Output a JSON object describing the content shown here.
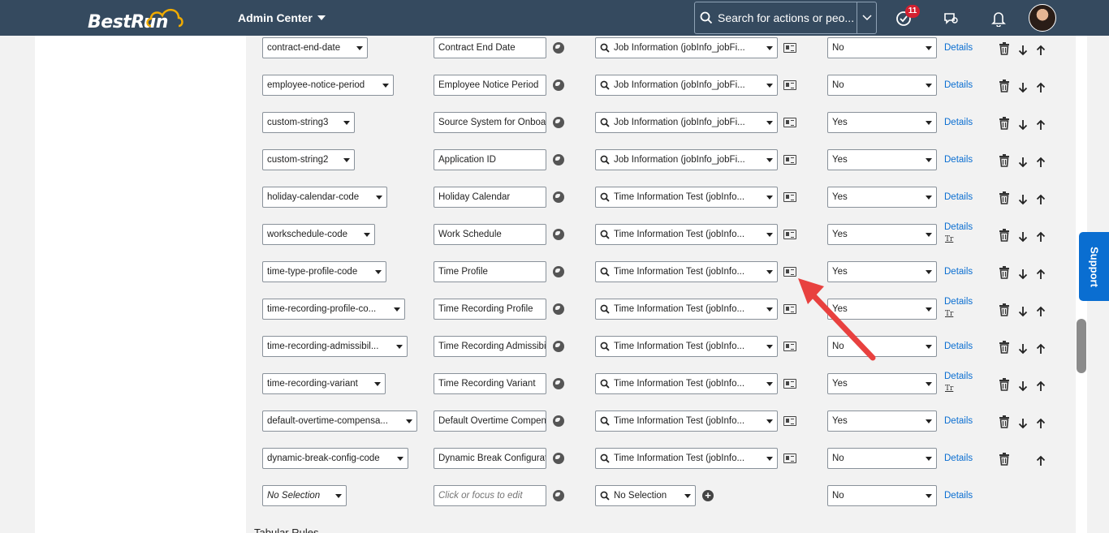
{
  "header": {
    "logo": "BestRun",
    "admin_center": "Admin Center",
    "search_placeholder": "Search for actions or peo...",
    "notification_count": "11"
  },
  "rows": [
    {
      "field": "contract-end-date",
      "label": "Contract End Date",
      "source": "Job Information (jobInfo_jobFi...",
      "visibility": "No",
      "details": "Details",
      "tr": "",
      "has_down": true
    },
    {
      "field": "employee-notice-period",
      "label": "Employee Notice Period",
      "source": "Job Information (jobInfo_jobFi...",
      "visibility": "No",
      "details": "Details",
      "tr": "",
      "has_down": true
    },
    {
      "field": "custom-string3",
      "label": "Source System for Onboarding",
      "source": "Job Information (jobInfo_jobFi...",
      "visibility": "Yes",
      "details": "Details",
      "tr": "",
      "has_down": true
    },
    {
      "field": "custom-string2",
      "label": "Application ID",
      "source": "Job Information (jobInfo_jobFi...",
      "visibility": "Yes",
      "details": "Details",
      "tr": "",
      "has_down": true
    },
    {
      "field": "holiday-calendar-code",
      "label": "Holiday Calendar",
      "source": "Time Information Test (jobInfo...",
      "visibility": "Yes",
      "details": "Details",
      "tr": "",
      "has_down": true
    },
    {
      "field": "workschedule-code",
      "label": "Work Schedule",
      "source": "Time Information Test (jobInfo...",
      "visibility": "Yes",
      "details": "Details",
      "tr": "Tr",
      "has_down": true
    },
    {
      "field": "time-type-profile-code",
      "label": "Time Profile",
      "source": "Time Information Test (jobInfo...",
      "visibility": "Yes",
      "details": "Details",
      "tr": "",
      "has_down": true
    },
    {
      "field": "time-recording-profile-co...",
      "label": "Time Recording Profile",
      "source": "Time Information Test (jobInfo...",
      "visibility": "Yes",
      "details": "Details",
      "tr": "Tr",
      "has_down": true
    },
    {
      "field": "time-recording-admissibil...",
      "label": "Time Recording Admissibility",
      "source": "Time Information Test (jobInfo...",
      "visibility": "No",
      "details": "Details",
      "tr": "",
      "has_down": true
    },
    {
      "field": "time-recording-variant",
      "label": "Time Recording Variant",
      "source": "Time Information Test (jobInfo...",
      "visibility": "Yes",
      "details": "Details",
      "tr": "Tr",
      "has_down": true
    },
    {
      "field": "default-overtime-compensa...",
      "label": "Default Overtime Compensation",
      "source": "Time Information Test (jobInfo...",
      "visibility": "Yes",
      "details": "Details",
      "tr": "",
      "has_down": true
    },
    {
      "field": "dynamic-break-config-code",
      "label": "Dynamic Break Configuration",
      "source": "Time Information Test (jobInfo...",
      "visibility": "No",
      "details": "Details",
      "tr": "",
      "has_down": false
    }
  ],
  "new_row": {
    "field": "No Selection",
    "label_placeholder": "Click or focus to edit",
    "source": "No Selection",
    "visibility": "No",
    "details": "Details"
  },
  "bottom_label": "Tabular Rules",
  "support": "Support",
  "colors": {
    "shell": "#354a5f",
    "link": "#0a6ed1",
    "annotation_arrow": "#e8413f",
    "support": "#0a6ed1"
  }
}
